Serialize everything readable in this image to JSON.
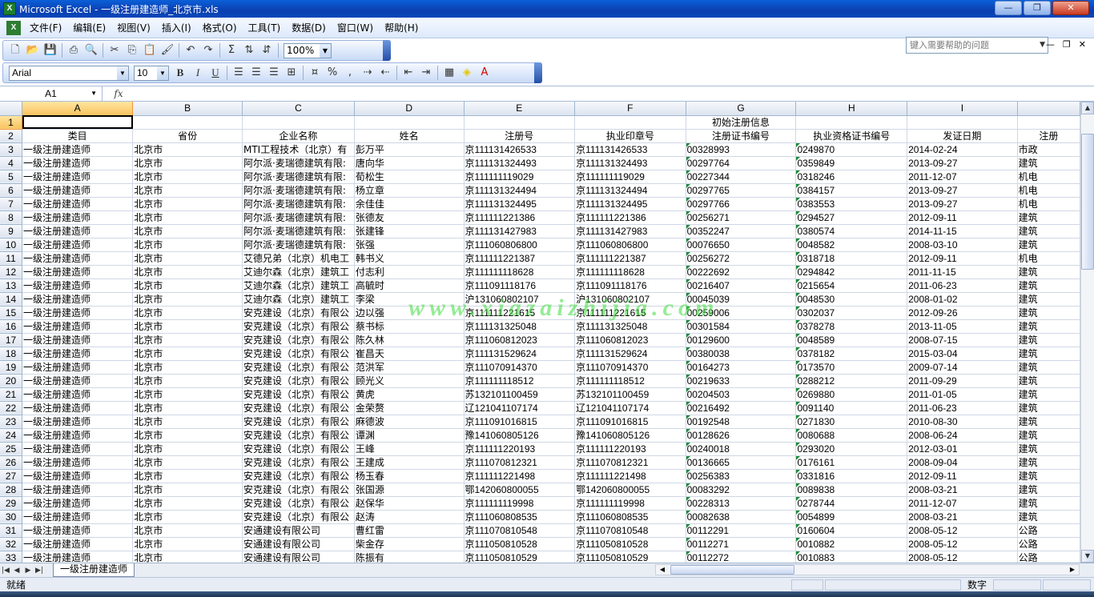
{
  "window": {
    "title": "Microsoft Excel - 一级注册建造师_北京市.xls"
  },
  "menu": [
    "文件(F)",
    "编辑(E)",
    "视图(V)",
    "插入(I)",
    "格式(O)",
    "工具(T)",
    "数据(D)",
    "窗口(W)",
    "帮助(H)"
  ],
  "help_placeholder": "键入需要帮助的问题",
  "toolbar": {
    "zoom": "100%",
    "font": "Arial",
    "size": "10",
    "bold": "B",
    "italic": "I",
    "underline": "U",
    "sigma": "Σ"
  },
  "formula": {
    "cell": "A1",
    "fx": "fx",
    "content": ""
  },
  "columns": [
    "A",
    "B",
    "C",
    "D",
    "E",
    "F",
    "G",
    "H",
    "I",
    ""
  ],
  "merged_header": "初始注册信息",
  "headers": [
    "类目",
    "省份",
    "企业名称",
    "姓名",
    "注册号",
    "执业印章号",
    "注册证书编号",
    "执业资格证书编号",
    "发证日期",
    "注册"
  ],
  "rows": [
    [
      "3",
      "一级注册建造师",
      "北京市",
      "MTI工程技术（北京）有",
      "彭万平",
      "京111131426533",
      "京111131426533",
      "00328993",
      "0249870",
      "2014-02-24",
      "市政"
    ],
    [
      "4",
      "一级注册建造师",
      "北京市",
      "阿尔派·麦瑞德建筑有限:",
      "唐向华",
      "京111131324493",
      "京111131324493",
      "00297764",
      "0359849",
      "2013-09-27",
      "建筑"
    ],
    [
      "5",
      "一级注册建造师",
      "北京市",
      "阿尔派·麦瑞德建筑有限:",
      "荀松生",
      "京111111119029",
      "京111111119029",
      "00227344",
      "0318246",
      "2011-12-07",
      "机电"
    ],
    [
      "6",
      "一级注册建造师",
      "北京市",
      "阿尔派·麦瑞德建筑有限:",
      "杨立章",
      "京111131324494",
      "京111131324494",
      "00297765",
      "0384157",
      "2013-09-27",
      "机电"
    ],
    [
      "7",
      "一级注册建造师",
      "北京市",
      "阿尔派·麦瑞德建筑有限:",
      "余佳佳",
      "京111131324495",
      "京111131324495",
      "00297766",
      "0383553",
      "2013-09-27",
      "机电"
    ],
    [
      "8",
      "一级注册建造师",
      "北京市",
      "阿尔派·麦瑞德建筑有限:",
      "张德友",
      "京111111221386",
      "京111111221386",
      "00256271",
      "0294527",
      "2012-09-11",
      "建筑"
    ],
    [
      "9",
      "一级注册建造师",
      "北京市",
      "阿尔派·麦瑞德建筑有限:",
      "张建锋",
      "京111131427983",
      "京111131427983",
      "00352247",
      "0380574",
      "2014-11-15",
      "建筑"
    ],
    [
      "10",
      "一级注册建造师",
      "北京市",
      "阿尔派·麦瑞德建筑有限:",
      "张强",
      "京111060806800",
      "京111060806800",
      "00076650",
      "0048582",
      "2008-03-10",
      "建筑"
    ],
    [
      "11",
      "一级注册建造师",
      "北京市",
      "艾德兄弟（北京）机电工",
      "韩书义",
      "京111111221387",
      "京111111221387",
      "00256272",
      "0318718",
      "2012-09-11",
      "机电"
    ],
    [
      "12",
      "一级注册建造师",
      "北京市",
      "艾迪尔森（北京）建筑工",
      "付志利",
      "京111111118628",
      "京111111118628",
      "00222692",
      "0294842",
      "2011-11-15",
      "建筑"
    ],
    [
      "13",
      "一级注册建造师",
      "北京市",
      "艾迪尔森（北京）建筑工",
      "高毓时",
      "京111091118176",
      "京111091118176",
      "00216407",
      "0215654",
      "2011-06-23",
      "建筑"
    ],
    [
      "14",
      "一级注册建造师",
      "北京市",
      "艾迪尔森（北京）建筑工",
      "李梁",
      "沪131060802107",
      "沪131060802107",
      "00045039",
      "0048530",
      "2008-01-02",
      "建筑"
    ],
    [
      "15",
      "一级注册建造师",
      "北京市",
      "安克建设（北京）有限公",
      "边以强",
      "京111111221615",
      "京111111221615",
      "00259006",
      "0302037",
      "2012-09-26",
      "建筑"
    ],
    [
      "16",
      "一级注册建造师",
      "北京市",
      "安克建设（北京）有限公",
      "蔡书标",
      "京111131325048",
      "京111131325048",
      "00301584",
      "0378278",
      "2013-11-05",
      "建筑"
    ],
    [
      "17",
      "一级注册建造师",
      "北京市",
      "安克建设（北京）有限公",
      "陈久林",
      "京111060812023",
      "京111060812023",
      "00129600",
      "0048589",
      "2008-07-15",
      "建筑"
    ],
    [
      "18",
      "一级注册建造师",
      "北京市",
      "安克建设（北京）有限公",
      "崔昌天",
      "京111131529624",
      "京111131529624",
      "00380038",
      "0378182",
      "2015-03-04",
      "建筑"
    ],
    [
      "19",
      "一级注册建造师",
      "北京市",
      "安克建设（北京）有限公",
      "范洪军",
      "京111070914370",
      "京111070914370",
      "00164273",
      "0173570",
      "2009-07-14",
      "建筑"
    ],
    [
      "20",
      "一级注册建造师",
      "北京市",
      "安克建设（北京）有限公",
      "顾光义",
      "京111111118512",
      "京111111118512",
      "00219633",
      "0288212",
      "2011-09-29",
      "建筑"
    ],
    [
      "21",
      "一级注册建造师",
      "北京市",
      "安克建设（北京）有限公",
      "黄虎",
      "苏132101100459",
      "苏132101100459",
      "00204503",
      "0269880",
      "2011-01-05",
      "建筑"
    ],
    [
      "22",
      "一级注册建造师",
      "北京市",
      "安克建设（北京）有限公",
      "金荣赘",
      "辽121041107174",
      "辽121041107174",
      "00216492",
      "0091140",
      "2011-06-23",
      "建筑"
    ],
    [
      "23",
      "一级注册建造师",
      "北京市",
      "安克建设（北京）有限公",
      "麻德波",
      "京111091016815",
      "京111091016815",
      "00192548",
      "0271830",
      "2010-08-30",
      "建筑"
    ],
    [
      "24",
      "一级注册建造师",
      "北京市",
      "安克建设（北京）有限公",
      "谭渊",
      "豫141060805126",
      "豫141060805126",
      "00128626",
      "0080688",
      "2008-06-24",
      "建筑"
    ],
    [
      "25",
      "一级注册建造师",
      "北京市",
      "安克建设（北京）有限公",
      "王峰",
      "京111111220193",
      "京111111220193",
      "00240018",
      "0293020",
      "2012-03-01",
      "建筑"
    ],
    [
      "26",
      "一级注册建造师",
      "北京市",
      "安克建设（北京）有限公",
      "王建成",
      "京111070812321",
      "京111070812321",
      "00136665",
      "0176161",
      "2008-09-04",
      "建筑"
    ],
    [
      "27",
      "一级注册建造师",
      "北京市",
      "安克建设（北京）有限公",
      "杨玉春",
      "京111111221498",
      "京111111221498",
      "00256383",
      "0331816",
      "2012-09-11",
      "建筑"
    ],
    [
      "28",
      "一级注册建造师",
      "北京市",
      "安克建设（北京）有限公",
      "张国源",
      "鄂142060800055",
      "鄂142060800055",
      "00083292",
      "0089838",
      "2008-03-21",
      "建筑"
    ],
    [
      "29",
      "一级注册建造师",
      "北京市",
      "安克建设（北京）有限公",
      "赵保华",
      "京111111119998",
      "京111111119998",
      "00228313",
      "0278744",
      "2011-12-07",
      "建筑"
    ],
    [
      "30",
      "一级注册建造师",
      "北京市",
      "安克建设（北京）有限公",
      "赵涛",
      "京111060808535",
      "京111060808535",
      "00082638",
      "0054899",
      "2008-03-21",
      "建筑"
    ],
    [
      "31",
      "一级注册建造师",
      "北京市",
      "安通建设有限公司",
      "曹红雷",
      "京111070810548",
      "京111070810548",
      "00112291",
      "0160604",
      "2008-05-12",
      "公路"
    ],
    [
      "32",
      "一级注册建造师",
      "北京市",
      "安通建设有限公司",
      "柴金存",
      "京111050810528",
      "京111050810528",
      "00112271",
      "0010882",
      "2008-05-12",
      "公路"
    ],
    [
      "33",
      "一级注册建造师",
      "北京市",
      "安通建设有限公司",
      "陈振有",
      "京111050810529",
      "京111050810529",
      "00112272",
      "0010883",
      "2008-05-12",
      "公路"
    ]
  ],
  "sheet_tab": "一级注册建造师",
  "status": {
    "ready": "就绪",
    "num": "数字"
  },
  "watermark": "www.xiazaizhijia.com"
}
